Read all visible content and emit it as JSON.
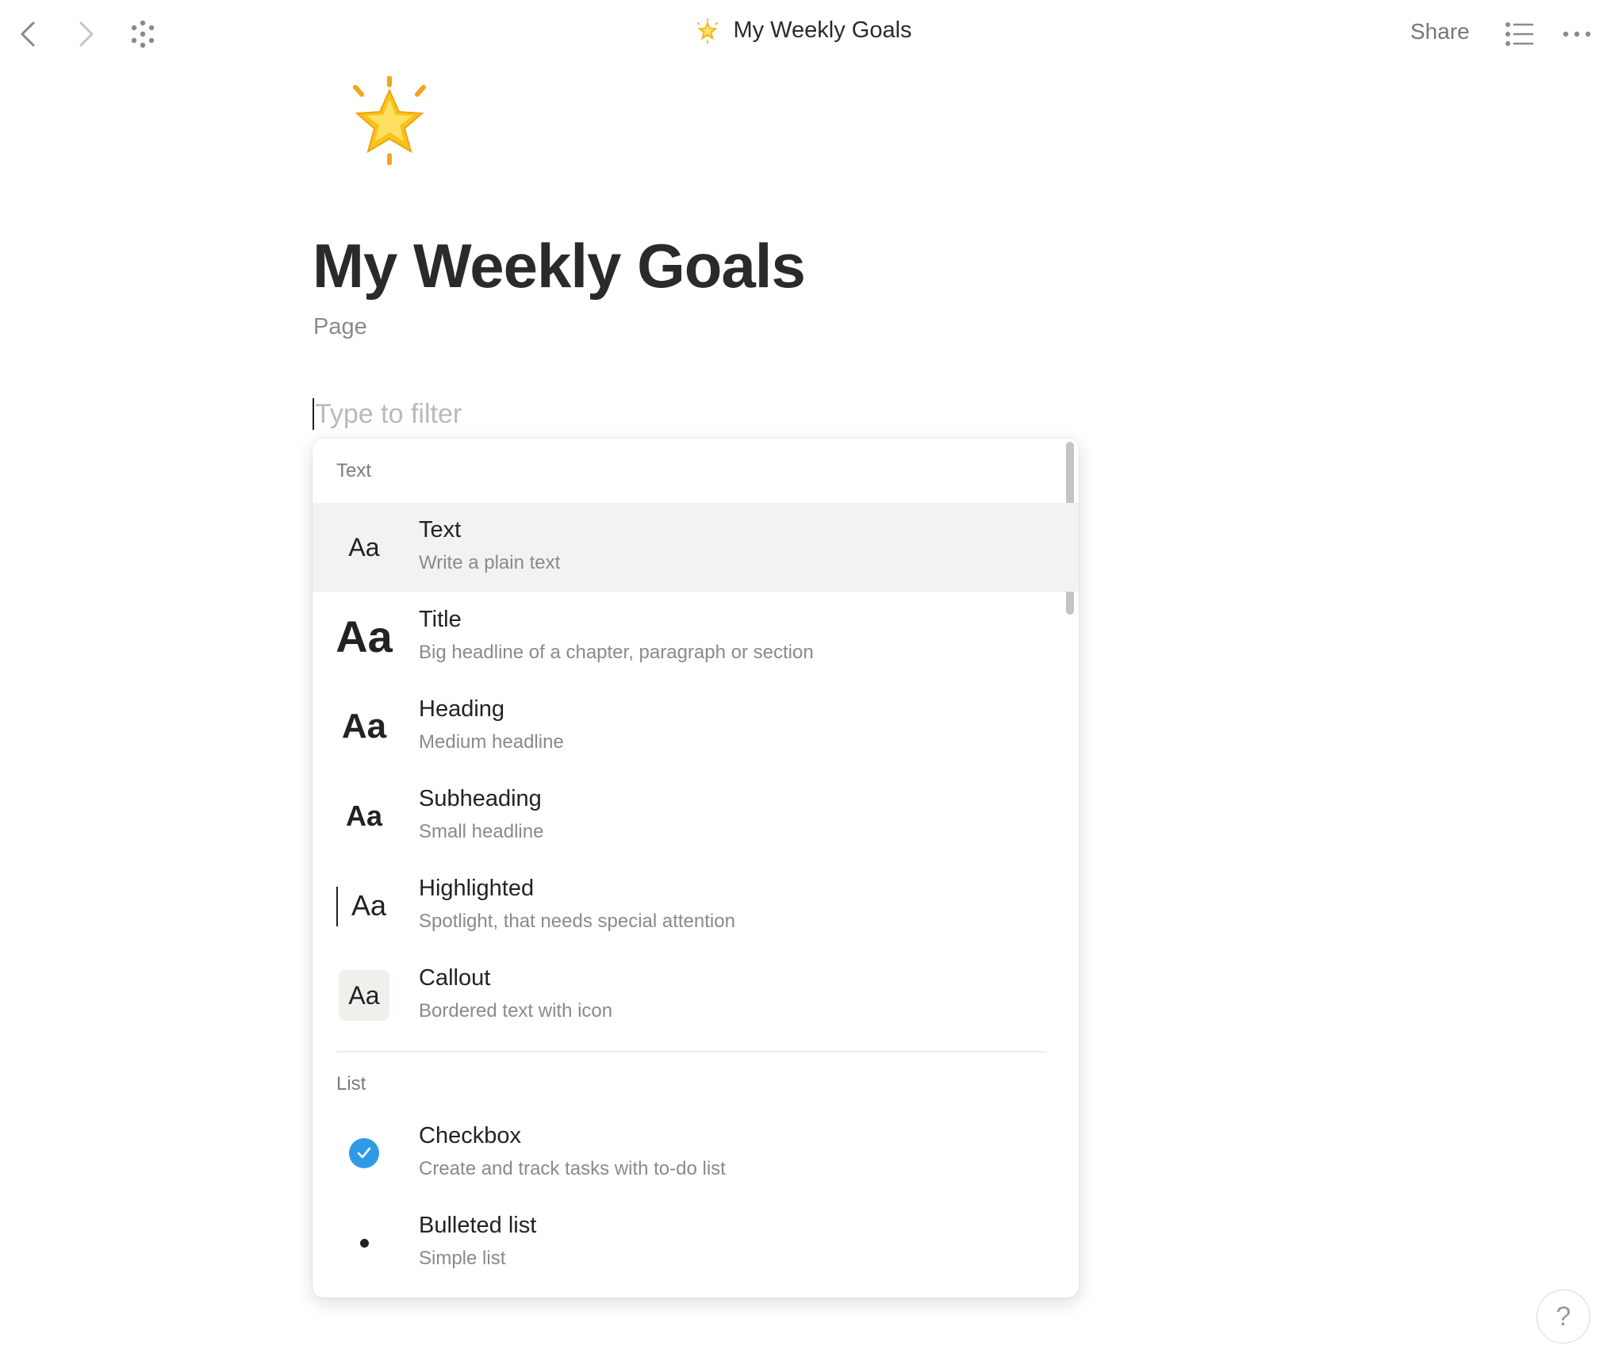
{
  "window": {
    "title": "My Weekly Goals",
    "icon": "glowing-star-icon"
  },
  "header": {
    "share_label": "Share",
    "back_icon": "chevron-left-icon",
    "forward_icon": "chevron-right-icon",
    "apps_icon": "dots-grid-icon",
    "toc_icon": "list-icon",
    "more_icon": "more-horizontal-icon"
  },
  "page": {
    "icon": "glowing-star-icon",
    "title": "My Weekly Goals",
    "subtitle": "Page"
  },
  "filter": {
    "placeholder": "Type to filter",
    "value": ""
  },
  "menu": {
    "sections": [
      {
        "label": "Text",
        "items": [
          {
            "icon_text": "Aa",
            "label": "Text",
            "description": "Write a plain text",
            "selected": true
          },
          {
            "icon_text": "Aa",
            "label": "Title",
            "description": "Big headline of a chapter, paragraph or section"
          },
          {
            "icon_text": "Aa",
            "label": "Heading",
            "description": "Medium headline"
          },
          {
            "icon_text": "Aa",
            "label": "Subheading",
            "description": "Small headline"
          },
          {
            "icon_text": "Aa",
            "label": "Highlighted",
            "description": "Spotlight, that needs special attention"
          },
          {
            "icon_text": "Aa",
            "label": "Callout",
            "description": "Bordered text with icon"
          }
        ]
      },
      {
        "label": "List",
        "items": [
          {
            "icon": "checkbox-checked-icon",
            "label": "Checkbox",
            "description": "Create and track tasks with to-do list"
          },
          {
            "icon": "bullet-icon",
            "label": "Bulleted list",
            "description": "Simple list"
          }
        ]
      }
    ]
  },
  "help": {
    "label": "?"
  },
  "colors": {
    "accent_blue": "#2e9ae6",
    "selected_bg": "#f2f2f2",
    "muted_text": "#8a8a8a",
    "callout_bg": "#f1efec"
  }
}
